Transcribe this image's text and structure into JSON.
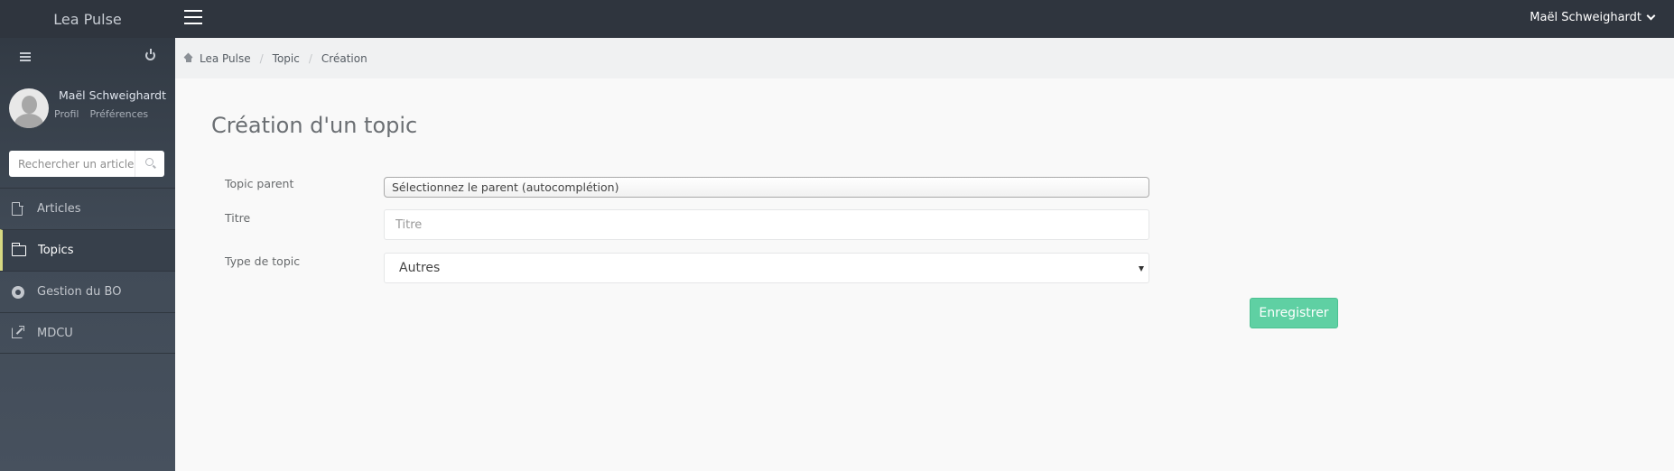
{
  "app": {
    "title": "Lea Pulse"
  },
  "topbar": {
    "user_name": "Maël Schweighardt"
  },
  "sidebar": {
    "user": {
      "name": "Maël Schweighardt",
      "profile_link": "Profil",
      "preferences_link": "Préférences"
    },
    "search": {
      "placeholder": "Rechercher un article"
    },
    "items": [
      {
        "label": "Articles",
        "icon": "file-icon",
        "active": false
      },
      {
        "label": "Topics",
        "icon": "folder-icon",
        "active": true
      },
      {
        "label": "Gestion du BO",
        "icon": "gear-icon",
        "active": false
      },
      {
        "label": "MDCU",
        "icon": "external-link-icon",
        "active": false
      }
    ]
  },
  "breadcrumb": {
    "items": [
      "Lea Pulse",
      "Topic",
      "Création"
    ]
  },
  "page": {
    "title": "Création d'un topic"
  },
  "form": {
    "parent": {
      "label": "Topic parent",
      "value": "Sélectionnez le parent (autocomplétion)"
    },
    "title": {
      "label": "Titre",
      "placeholder": "Titre",
      "value": ""
    },
    "type": {
      "label": "Type de topic",
      "selected": "Autres"
    },
    "save_label": "Enregistrer"
  },
  "colors": {
    "topbar": "#2f353e",
    "sidebar": "#3f4854",
    "active_accent": "#d7d982",
    "save_button": "#5fd0a3",
    "background": "#f9f9f9"
  }
}
